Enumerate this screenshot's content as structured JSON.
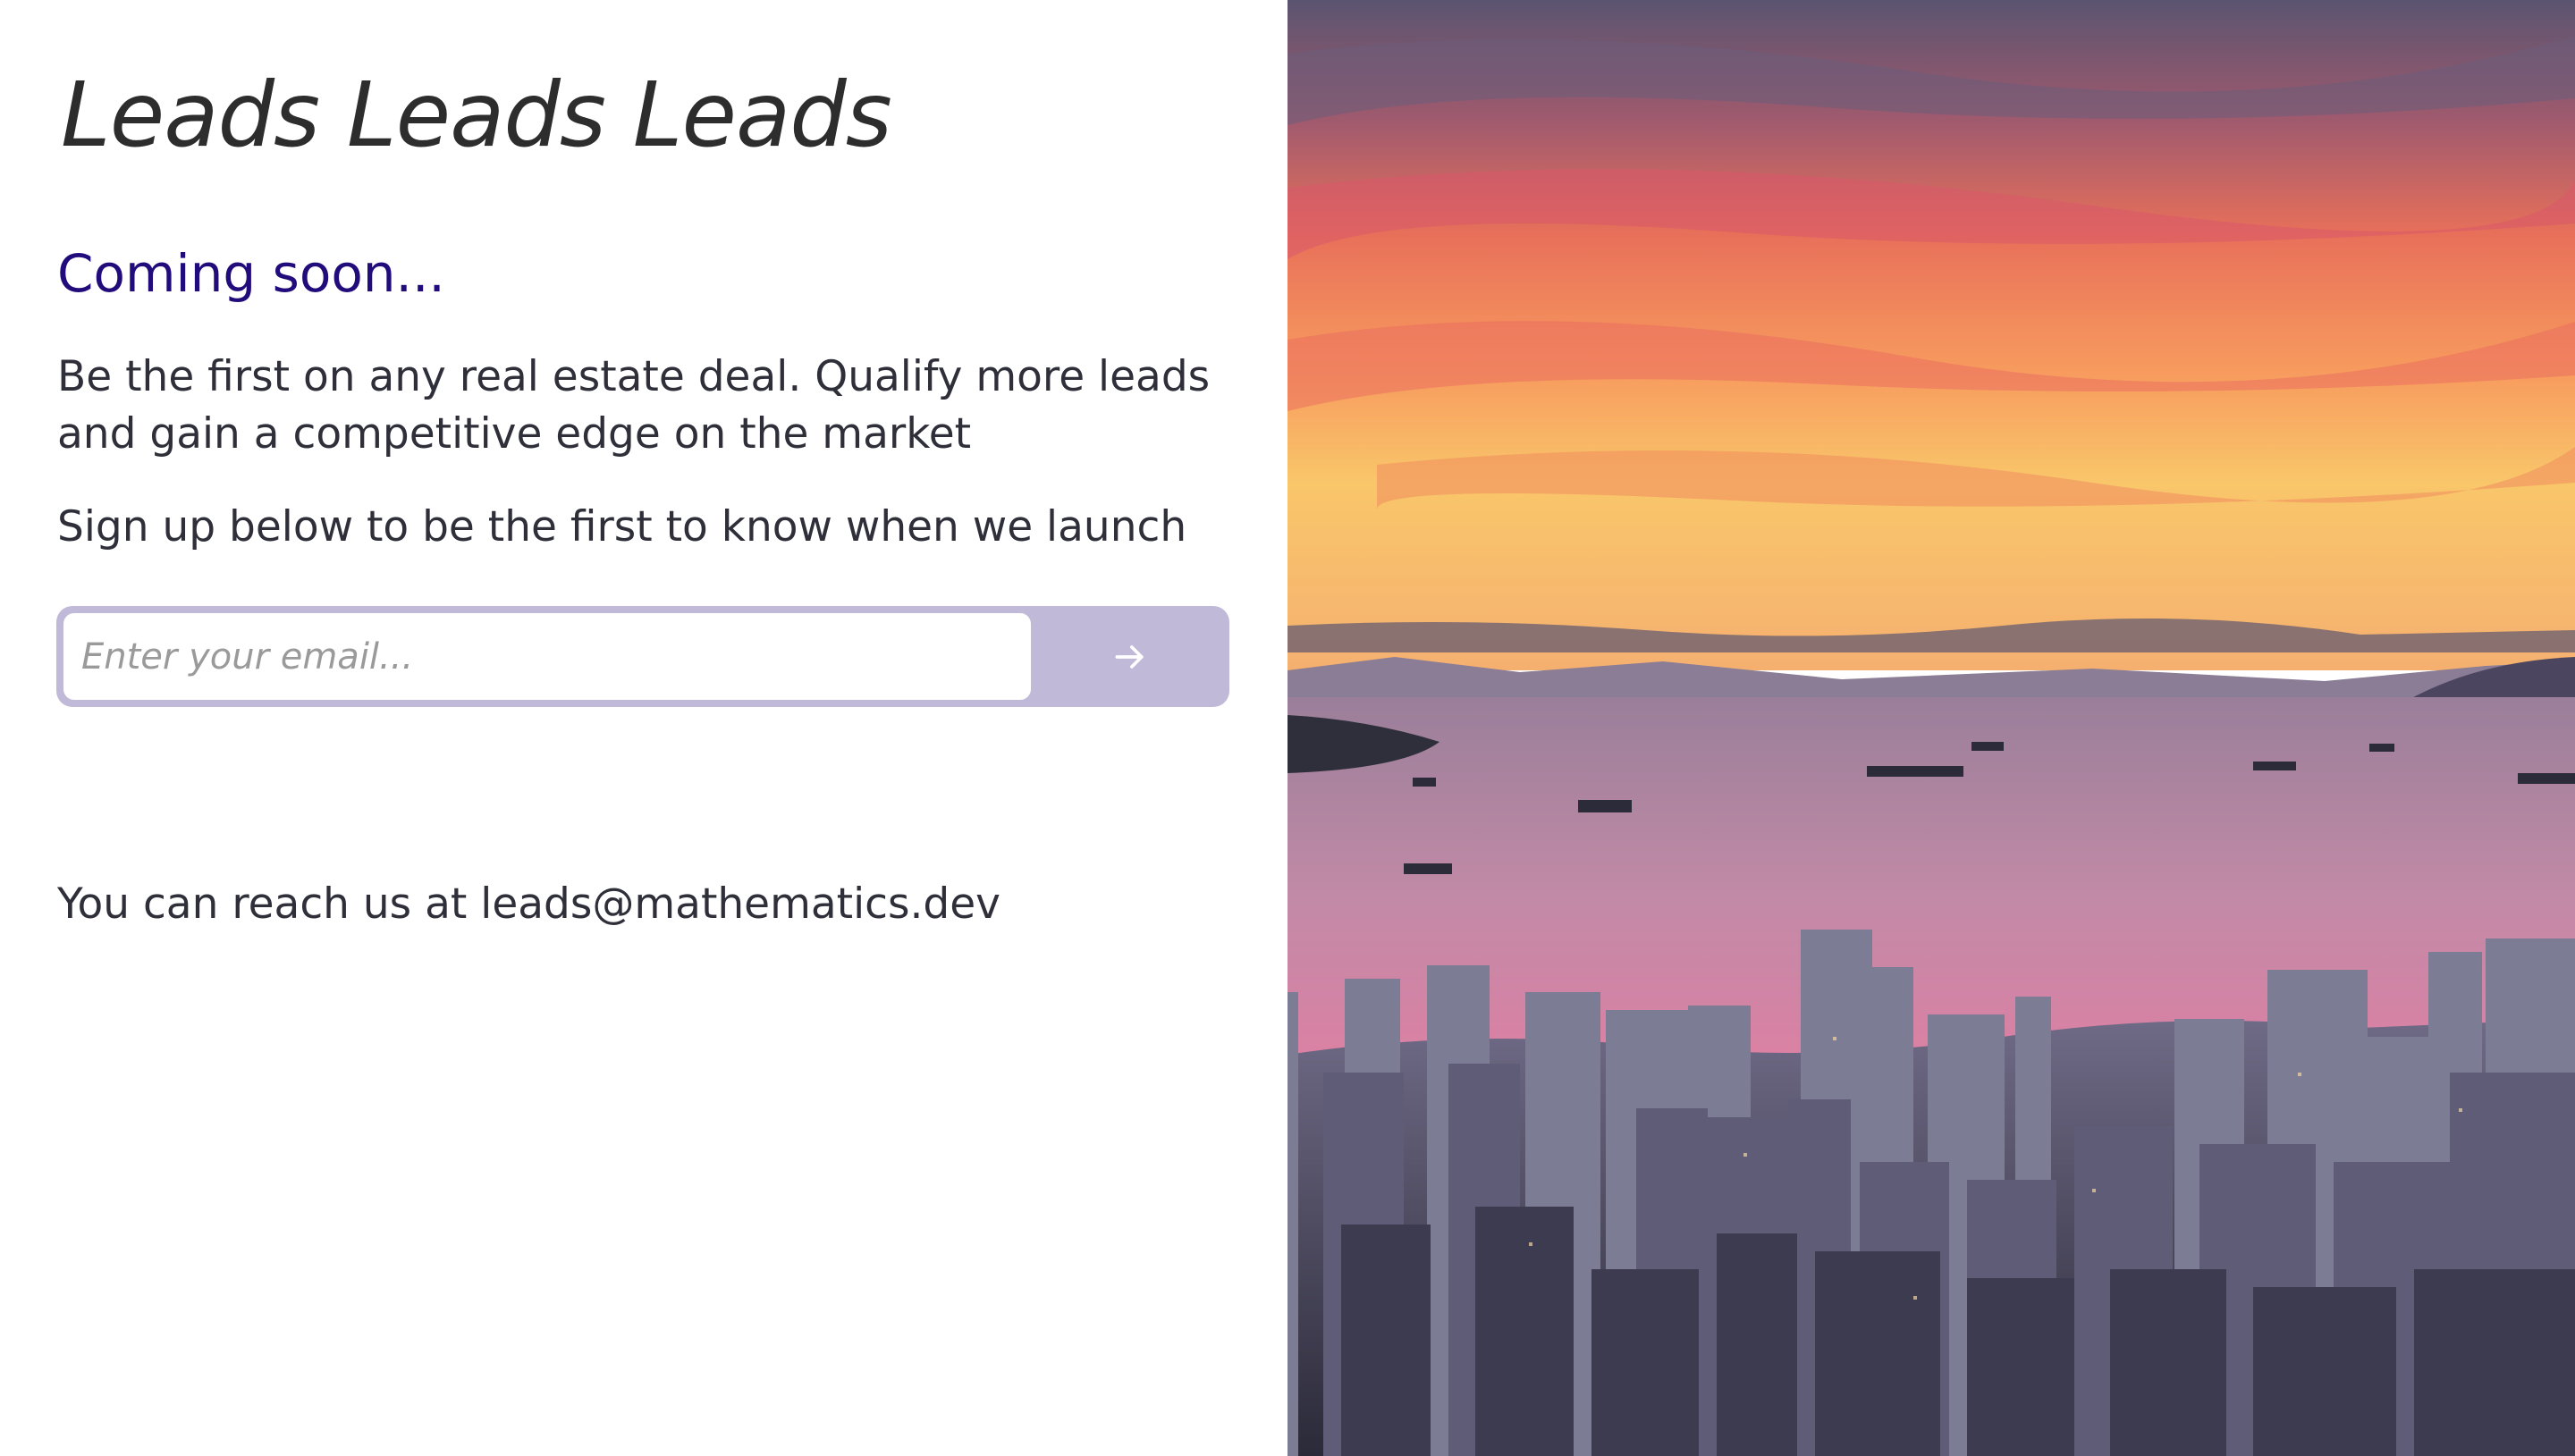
{
  "brand": {
    "title": "Leads Leads Leads"
  },
  "hero": {
    "heading": "Coming soon...",
    "description": "Be the first on any real estate deal. Qualify more leads and gain a competitive edge on the market",
    "signup_prompt": "Sign up below to be the first to know when we launch"
  },
  "form": {
    "email_placeholder": "Enter your email...",
    "email_value": "",
    "submit_icon": "arrow-right-icon"
  },
  "contact": {
    "text": "You can reach us at leads@mathematics.dev"
  },
  "photo": {
    "subject": "city-skyline-sunset-over-bay"
  },
  "colors": {
    "heading": "#220c7c",
    "form_background": "#c0bad8",
    "text": "#2f2f3a"
  }
}
